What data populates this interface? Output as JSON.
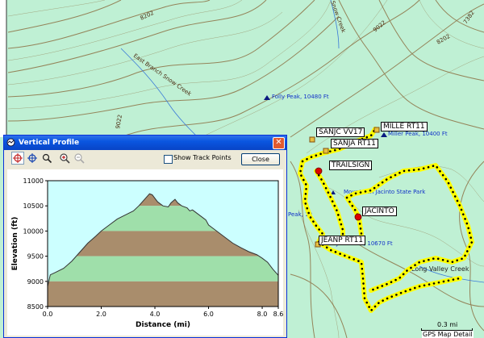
{
  "map": {
    "contour_labels": [
      "8202",
      "East Branch Snow Creek",
      "Snow Creek",
      "9022",
      "7382",
      "8202",
      "9022",
      "9022"
    ],
    "peaks": [
      {
        "name": "Folly Peak, 10480 Ft"
      },
      {
        "name": "Miller Peak, 10400 Ft"
      },
      {
        "name": "Mount San Jacinto State Park"
      },
      {
        "name": "Peak, 10"
      },
      {
        "name": "Jean Peak, 10670 Ft"
      }
    ],
    "creek_label": "Long Valley Creek",
    "waypoints": [
      "SANJC VV17",
      "MILLE RT11",
      "SANJA RT11",
      "TRAILSIGN",
      "JACINTO",
      "JEANP RT11"
    ],
    "scale": {
      "distance": "0.3 mi",
      "caption": "GPS Map Detail"
    },
    "colors": {
      "background": "#bff0d4",
      "contour": "#8a6a3c",
      "track_highlight": "#ffff00",
      "track_dots": "#000000"
    }
  },
  "window": {
    "title": "Vertical Profile",
    "show_track_points_label": "Show Track Points",
    "show_track_points_checked": false,
    "close_button": "Close",
    "tools": [
      "select-tool-icon",
      "pan-tool-icon",
      "measure-tool-icon",
      "zoom-in-icon",
      "zoom-out-icon"
    ]
  },
  "chart_data": {
    "type": "area",
    "xlabel": "Distance  (mi)",
    "ylabel": "Elevation (ft)",
    "xlim": [
      0,
      8.6
    ],
    "ylim": [
      8500,
      11000
    ],
    "x_ticks": [
      "0.0",
      "2.0",
      "4.0",
      "6.0",
      "8.0",
      "8.6"
    ],
    "x_tick_values": [
      0,
      2,
      4,
      6,
      8,
      8.6
    ],
    "y_ticks": [
      "11000",
      "10500",
      "10000",
      "9500",
      "9000",
      "8500"
    ],
    "y_tick_values": [
      11000,
      10500,
      10000,
      9500,
      9000,
      8500
    ],
    "band_colors": [
      "#a98d6c",
      "#9fdfaa"
    ],
    "sky_color": "#ccffff",
    "x": [
      0,
      0.1,
      0.3,
      0.6,
      0.9,
      1.2,
      1.5,
      1.8,
      2.0,
      2.3,
      2.6,
      2.9,
      3.2,
      3.4,
      3.6,
      3.8,
      3.9,
      4.1,
      4.3,
      4.5,
      4.6,
      4.75,
      4.85,
      5.0,
      5.2,
      5.3,
      5.4,
      5.5,
      5.7,
      5.9,
      6.0,
      6.3,
      6.6,
      6.9,
      7.2,
      7.5,
      7.8,
      8.0,
      8.2,
      8.4,
      8.6
    ],
    "y": [
      8900,
      9130,
      9180,
      9260,
      9400,
      9580,
      9760,
      9900,
      10000,
      10120,
      10240,
      10320,
      10400,
      10500,
      10620,
      10740,
      10720,
      10580,
      10500,
      10480,
      10560,
      10630,
      10560,
      10500,
      10460,
      10400,
      10420,
      10380,
      10300,
      10220,
      10120,
      10000,
      9880,
      9760,
      9670,
      9590,
      9530,
      9460,
      9380,
      9240,
      9120
    ]
  }
}
